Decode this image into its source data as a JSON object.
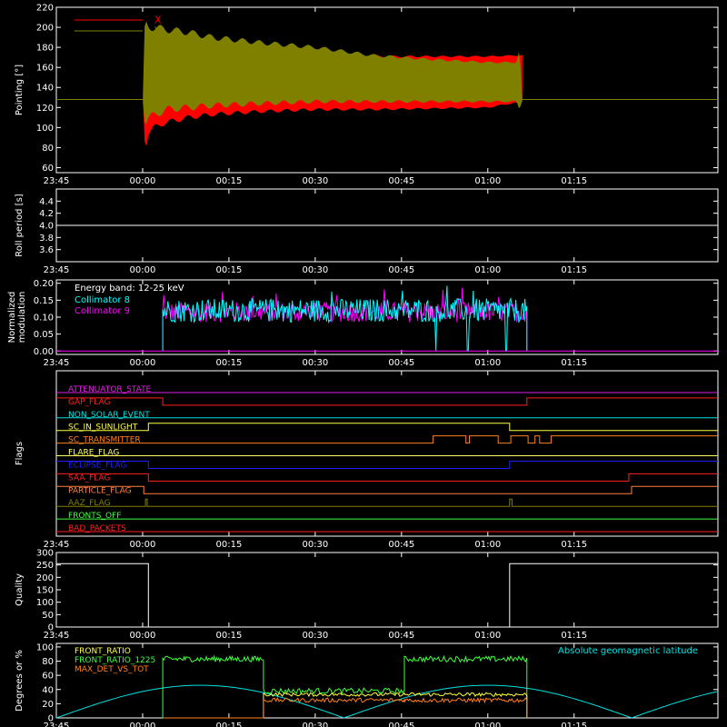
{
  "chart_data": [
    {
      "type": "line",
      "id": "pointing",
      "ylabel": "Pointing [°]",
      "ylim": [
        55,
        220
      ],
      "yticks": [
        60,
        80,
        100,
        120,
        140,
        160,
        180,
        200,
        220
      ],
      "legend_placement": "top-left",
      "series": [
        {
          "name": "X",
          "color": "#ff0000",
          "x": [
            0.05,
            0.12,
            0.5,
            1.0,
            2.0,
            4.0,
            8.0,
            12.0,
            20.0,
            30.0,
            40.0,
            50.0,
            60.0,
            65.0,
            65.5,
            66.0
          ],
          "upper": [
            130,
            175,
            190,
            185,
            186,
            182,
            175,
            173,
            172,
            172,
            171,
            171,
            171,
            172,
            172,
            172
          ],
          "lower": [
            128,
            100,
            80,
            95,
            100,
            105,
            110,
            113,
            116,
            118,
            118,
            119,
            120,
            125,
            120,
            128
          ]
        },
        {
          "name": "Y",
          "color": "#808000",
          "x": [
            0.05,
            0.12,
            0.5,
            1.0,
            2.0,
            4.0,
            8.0,
            12.0,
            20.0,
            30.0,
            40.0,
            50.0,
            60.0,
            65.0,
            65.5,
            66.0
          ],
          "upper": [
            130,
            185,
            205,
            200,
            200,
            198,
            195,
            190,
            185,
            180,
            172,
            168,
            165,
            165,
            178,
            128
          ],
          "lower": [
            128,
            115,
            105,
            110,
            112,
            118,
            120,
            122,
            124,
            126,
            126,
            126,
            126,
            126,
            118,
            128
          ]
        }
      ],
      "reference_line": 128
    },
    {
      "type": "line",
      "id": "roll_period",
      "ylabel": "Roll period [s]",
      "ylim": [
        3.4,
        4.6
      ],
      "yticks": [
        3.6,
        3.8,
        4.0,
        4.2,
        4.4
      ],
      "series": [
        {
          "color": "#ffffff",
          "x": [
            -15,
            100
          ],
          "y": [
            4.0,
            4.0
          ]
        }
      ]
    },
    {
      "type": "line",
      "id": "modulation",
      "ylabel": "Normalized modulation",
      "ylim": [
        -0.01,
        0.21
      ],
      "yticks": [
        0.0,
        0.05,
        0.1,
        0.15,
        0.2
      ],
      "annotation": "Energy band: 12-25 keV",
      "series": [
        {
          "name": "Collimator 8",
          "color": "#00ffff",
          "x_start": 3.5,
          "x_end": 66.8,
          "baseline": 0.12,
          "amplitude": 0.035,
          "dropouts": [
            51.0,
            56.5,
            63.2
          ]
        },
        {
          "name": "Collimator 9",
          "color": "#ff00ff",
          "x_start": 3.5,
          "x_end": 66.8,
          "baseline": 0.115,
          "amplitude": 0.03
        }
      ]
    },
    {
      "type": "line",
      "id": "flags",
      "ylabel": "Flags",
      "flags": [
        {
          "name": "ATTENUATOR_STATE",
          "color": "#e020e0",
          "x": [
            -15,
            100
          ],
          "s": [
            0,
            0
          ]
        },
        {
          "name": "GAP_FLAG",
          "color": "#ff2020",
          "x": [
            -15,
            3.5,
            3.5,
            66.8,
            66.8,
            100
          ],
          "s": [
            1,
            1,
            0,
            0,
            1,
            1
          ]
        },
        {
          "name": "NON_SOLAR_EVENT",
          "color": "#00e0e0",
          "x": [
            -15,
            100
          ],
          "s": [
            0,
            0
          ]
        },
        {
          "name": "SC_IN_SUNLIGHT",
          "color": "#ffff40",
          "x": [
            -15,
            1.0,
            1.0,
            63.8,
            63.8,
            100
          ],
          "s": [
            0,
            0,
            1,
            1,
            0,
            0
          ]
        },
        {
          "name": "SC_TRANSMITTER",
          "color": "#ff8020",
          "x": [
            -15,
            50.5,
            50.5,
            56.2,
            56.2,
            56.8,
            56.8,
            61.8,
            61.8,
            64.0,
            64.0,
            67.0,
            67.0,
            68.2,
            68.2,
            69.0,
            69.0,
            71.0,
            71.0,
            100
          ],
          "s": [
            0,
            0,
            1,
            1,
            0,
            0,
            1,
            1,
            0,
            0,
            1,
            1,
            0,
            0,
            1,
            1,
            0,
            0,
            1,
            1
          ]
        },
        {
          "name": "FLARE_FLAG",
          "color": "#ffff60",
          "x": [
            -15,
            100
          ],
          "s": [
            0,
            0
          ]
        },
        {
          "name": "ECLIPSE_FLAG",
          "color": "#2020ff",
          "x": [
            -15,
            1.0,
            1.0,
            63.8,
            63.8,
            100
          ],
          "s": [
            1,
            1,
            0,
            0,
            1,
            1
          ]
        },
        {
          "name": "SAA_FLAG",
          "color": "#ff2020",
          "x": [
            -15,
            1.0,
            1.0,
            84.5,
            84.5,
            100
          ],
          "s": [
            1,
            1,
            0,
            0,
            1,
            1
          ]
        },
        {
          "name": "PARTICLE_FLAG",
          "color": "#ff8040",
          "x": [
            -15,
            0.2,
            0.2,
            85.0,
            85.0,
            100
          ],
          "s": [
            1,
            1,
            0,
            0,
            1,
            1
          ]
        },
        {
          "name": "AAZ_FLAG",
          "color": "#808000",
          "x": [
            -15,
            0.5,
            0.5,
            0.8,
            0.8,
            63.8,
            63.8,
            64.2,
            64.2,
            100
          ],
          "s": [
            0,
            0,
            1,
            1,
            0,
            0,
            1,
            1,
            0,
            0
          ]
        },
        {
          "name": "FRONTS_OFF",
          "color": "#40ff40",
          "x": [
            -15,
            100
          ],
          "s": [
            0,
            0
          ]
        },
        {
          "name": "BAD_PACKETS",
          "color": "#ff2020",
          "x": [
            -15,
            100
          ],
          "s": [
            0,
            0
          ]
        }
      ]
    },
    {
      "type": "line",
      "id": "quality",
      "ylabel": "Quality",
      "ylim": [
        0,
        300
      ],
      "yticks": [
        0,
        50,
        100,
        150,
        200,
        250,
        300
      ],
      "series": [
        {
          "color": "#ffffff",
          "x": [
            -15,
            1.0,
            1.0,
            63.8,
            63.8,
            100
          ],
          "y": [
            255,
            255,
            0,
            0,
            255,
            255
          ]
        }
      ]
    },
    {
      "type": "line",
      "id": "ratios",
      "ylabel": "Degrees or %",
      "ylim": [
        0,
        105
      ],
      "yticks": [
        0,
        20,
        40,
        60,
        80,
        100
      ],
      "annotation": "Absolute geomagnetic latitude",
      "series": [
        {
          "name": "FRONT_RATIO",
          "color": "#ffff40"
        },
        {
          "name": "FRONT_RATIO_1225",
          "color": "#40ff40"
        },
        {
          "name": "MAX_DET_VS_TOT",
          "color": "#ff8020"
        },
        {
          "name": "Absolute geomagnetic latitude",
          "color": "#00e0e0"
        }
      ],
      "segments": [
        {
          "x_start": 3.5,
          "x_end": 21.0,
          "front_ratio_1225": 83,
          "front_ratio": 0,
          "max_det": 0
        },
        {
          "x_start": 21.0,
          "x_end": 45.5,
          "front_ratio_1225": 38,
          "front_ratio": 33,
          "max_det": 25
        },
        {
          "x_start": 45.5,
          "x_end": 66.8,
          "front_ratio_1225": 83,
          "front_ratio": 33,
          "max_det": 25
        }
      ]
    }
  ],
  "x_axis": {
    "xlim": [
      -15,
      100
    ],
    "tick_values": [
      -15,
      0,
      15,
      30,
      45,
      60,
      75
    ],
    "tick_labels": [
      "23:45",
      "00:00",
      "00:15",
      "00:30",
      "00:45",
      "01:00",
      "01:15"
    ]
  },
  "colors": {
    "background": "#000000",
    "axis": "#ffffff"
  }
}
